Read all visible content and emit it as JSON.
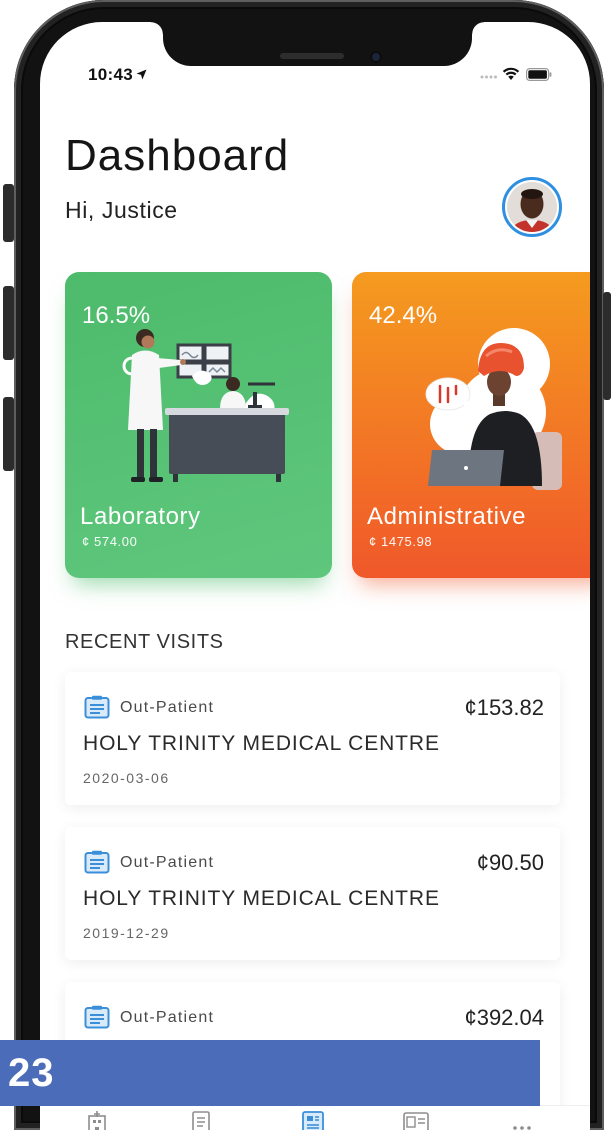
{
  "status_bar": {
    "time": "10:43",
    "icons": [
      "location-arrow-icon",
      "signal-icon",
      "wifi-icon",
      "battery-icon"
    ]
  },
  "header": {
    "title": "Dashboard",
    "greeting": "Hi, Justice"
  },
  "category_cards": [
    {
      "percent": "16.5%",
      "label": "Laboratory",
      "amount": "¢ 574.00",
      "illustration_icon": "laboratory-illustration"
    },
    {
      "percent": "42.4%",
      "label": "Administrative",
      "amount": "¢ 1475.98",
      "illustration_icon": "administrative-illustration"
    }
  ],
  "recent_visits": {
    "heading": "RECENT VISITS",
    "item_icon": "clipboard-icon",
    "items": [
      {
        "type": "Out-Patient",
        "amount": "¢153.82",
        "facility": "HOLY TRINITY MEDICAL CENTRE",
        "date": "2020-03-06"
      },
      {
        "type": "Out-Patient",
        "amount": "¢90.50",
        "facility": "HOLY TRINITY MEDICAL CENTRE",
        "date": "2019-12-29"
      },
      {
        "type": "Out-Patient",
        "amount": "¢392.04"
      }
    ]
  },
  "tab_bar": {
    "active_index": 2,
    "items": [
      {
        "icon": "hospital-icon"
      },
      {
        "icon": "document-icon"
      },
      {
        "icon": "dashboard-icon"
      },
      {
        "icon": "id-card-icon"
      },
      {
        "icon": "more-icon"
      }
    ]
  },
  "overlay": {
    "label": "23"
  },
  "colors": {
    "laboratory_card": "#4dbb6b",
    "administrative_card_top": "#f59b1f",
    "administrative_card_bottom": "#f0582a",
    "accent": "#3b8fd9",
    "overlay_banner": "#4b6cb8"
  }
}
